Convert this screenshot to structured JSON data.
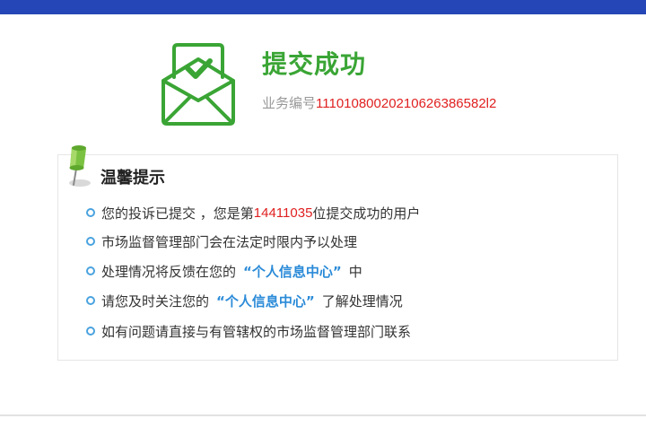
{
  "header": {
    "bar_color": "#2546b6"
  },
  "result": {
    "title": "提交成功",
    "business_label": "业务编号",
    "business_number": "11101080020210626386582l2",
    "icon": "envelope-check-icon",
    "accent_color": "#3aa535"
  },
  "tips": {
    "title": "温馨提示",
    "icon": "pushpin-icon",
    "item1": {
      "prefix": "您的投诉已提交 ，您是第",
      "count": "14411035",
      "suffix": "位提交成功的用户"
    },
    "item2": {
      "text": "市场监督管理部门会在法定时限内予以处理"
    },
    "item3": {
      "prefix": "处理情况将反馈在您的",
      "link": "“个人信息中心”",
      "suffix": "中"
    },
    "item4": {
      "prefix": "请您及时关注您的",
      "link": "“个人信息中心”",
      "suffix": "了解处理情况"
    },
    "item5": {
      "text": "如有问题请直接与有管辖权的市场监督管理部门联系"
    },
    "bullet_color": "#4aa3df",
    "highlight_color": "#e02020",
    "link_color": "#2b8bd8"
  }
}
